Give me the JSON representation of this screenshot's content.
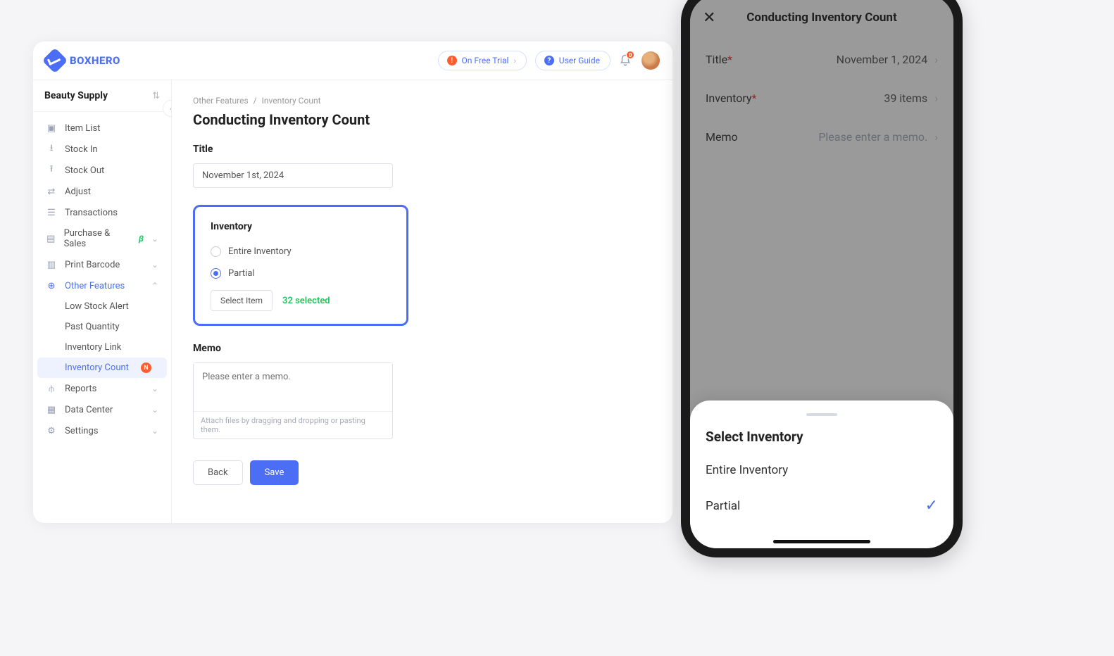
{
  "brand": {
    "name": "BOXHERO"
  },
  "topbar": {
    "trial_label": "On Free Trial",
    "guide_label": "User Guide",
    "notif_count": "0"
  },
  "team": {
    "name": "Beauty Supply"
  },
  "nav": {
    "item_list": "Item List",
    "stock_in": "Stock In",
    "stock_out": "Stock Out",
    "adjust": "Adjust",
    "transactions": "Transactions",
    "purchase_sales": "Purchase & Sales",
    "beta": "β",
    "print_barcode": "Print Barcode",
    "other_features": "Other Features",
    "low_stock": "Low Stock Alert",
    "past_quantity": "Past Quantity",
    "inventory_link": "Inventory Link",
    "inventory_count": "Inventory Count",
    "n_badge": "N",
    "reports": "Reports",
    "data_center": "Data Center",
    "settings": "Settings"
  },
  "breadcrumb": {
    "a": "Other Features",
    "b": "Inventory Count"
  },
  "page": {
    "title": "Conducting Inventory Count",
    "section_title": "Title",
    "title_value": "November 1st, 2024",
    "section_inventory": "Inventory",
    "radio_entire": "Entire Inventory",
    "radio_partial": "Partial",
    "select_item_btn": "Select Item",
    "selected_text": "32 selected",
    "section_memo": "Memo",
    "memo_placeholder": "Please enter a memo.",
    "attach_hint": "Attach files by dragging and dropping or pasting them.",
    "back_btn": "Back",
    "save_btn": "Save"
  },
  "mobile": {
    "header": "Conducting Inventory Count",
    "row_title_label": "Title",
    "row_title_value": "November 1, 2024",
    "row_inv_label": "Inventory",
    "row_inv_value": "39 items",
    "row_memo_label": "Memo",
    "row_memo_placeholder": "Please enter a memo.",
    "sheet_title": "Select Inventory",
    "opt_entire": "Entire Inventory",
    "opt_partial": "Partial"
  }
}
